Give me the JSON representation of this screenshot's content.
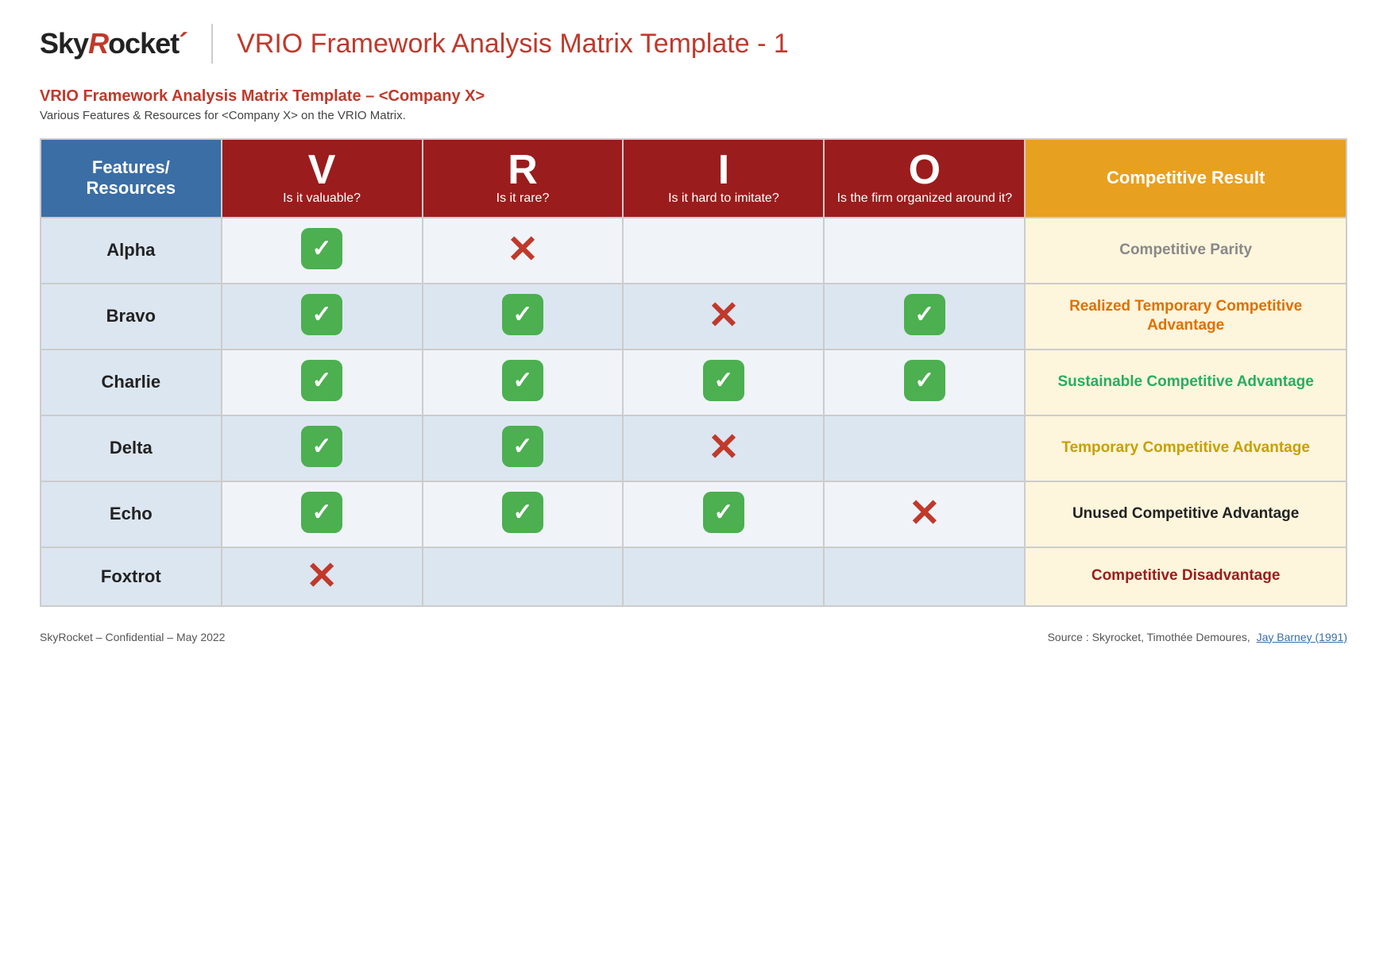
{
  "header": {
    "logo_sky": "Sky",
    "logo_r": "R",
    "logo_rocket": "ocket",
    "page_title": "VRIO Framework Analysis Matrix Template - 1"
  },
  "subtitle": {
    "title": "VRIO Framework Analysis Matrix Template – <Company X>",
    "description": "Various Features & Resources for <Company X> on the VRIO Matrix."
  },
  "table": {
    "col_features_label": "Features/ Resources",
    "col_v_letter": "V",
    "col_v_sub": "Is it valuable?",
    "col_r_letter": "R",
    "col_r_sub": "Is it rare?",
    "col_i_letter": "I",
    "col_i_sub": "Is it hard to imitate?",
    "col_o_letter": "O",
    "col_o_sub": "Is the firm organized around it?",
    "col_result_label": "Competitive Result",
    "rows": [
      {
        "name": "Alpha",
        "v": "check",
        "r": "cross",
        "i": "",
        "o": "",
        "result": "Competitive Parity",
        "result_class": "result-gray"
      },
      {
        "name": "Bravo",
        "v": "check",
        "r": "check",
        "i": "cross",
        "o": "check",
        "result": "Realized Temporary Competitive Advantage",
        "result_class": "result-orange"
      },
      {
        "name": "Charlie",
        "v": "check",
        "r": "check",
        "i": "check",
        "o": "check",
        "result": "Sustainable Competitive Advantage",
        "result_class": "result-green"
      },
      {
        "name": "Delta",
        "v": "check",
        "r": "check",
        "i": "cross",
        "o": "",
        "result": "Temporary Competitive Advantage",
        "result_class": "result-tan"
      },
      {
        "name": "Echo",
        "v": "check",
        "r": "check",
        "i": "check",
        "o": "cross",
        "result": "Unused Competitive Advantage",
        "result_class": "result-black"
      },
      {
        "name": "Foxtrot",
        "v": "cross",
        "r": "",
        "i": "",
        "o": "",
        "result": "Competitive Disadvantage",
        "result_class": "result-darkred"
      }
    ]
  },
  "footer": {
    "left": "SkyRocket – Confidential – May 2022",
    "right_text": "Source : Skyrocket, Timothée Demoures,",
    "right_link_text": "Jay Barney (1991)",
    "right_link_href": "#"
  }
}
